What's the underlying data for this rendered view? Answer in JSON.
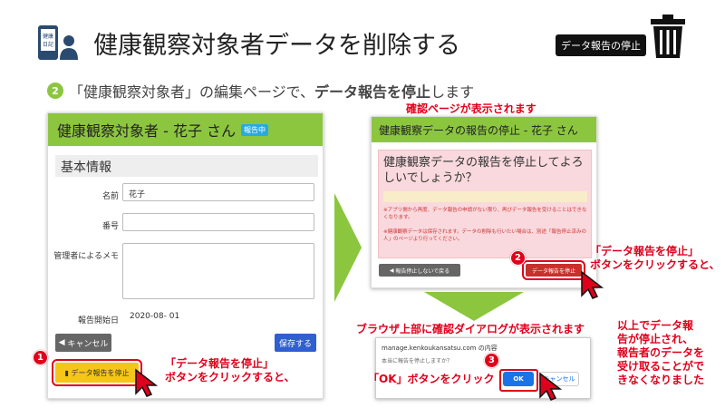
{
  "header": {
    "title": "健康観察対象者データを削除する",
    "badge": "データ報告の停止",
    "icon_text_line1": "健康",
    "icon_text_line2": "日記"
  },
  "step": {
    "number": "2",
    "text_before": "「健康観察対象者」の編集ページで、",
    "text_bold": "データ報告を停止",
    "text_after": "します"
  },
  "left_panel": {
    "title": "健康観察対象者 - 花子 さん",
    "status_badge": "報告中",
    "section": "基本情報",
    "fields": [
      {
        "label": "名前",
        "value": "花子"
      },
      {
        "label": "番号",
        "value": ""
      },
      {
        "label": "管理者によるメモ",
        "value": ""
      }
    ],
    "report_start_label": "報告開始日",
    "report_start_value": "2020-08- 01",
    "cancel_label": "キャンセル",
    "save_label": "保存する",
    "stop_label": "データ報告を停止"
  },
  "right_panel": {
    "caption": "確認ページが表示されます",
    "title": "健康観察データの報告の停止 - 花子 さん",
    "alert_title": "健康観察データの報告を停止してよろしいでしょうか？",
    "note1": "※アプリ側から再度、データ報告の申請がない限り、再びデータ報告を受けることはできなくなります。",
    "note2": "※健康観察データは保存されます。データの削除も行いたい場合は、別途「報告停止済みの人」のページより行ってください。",
    "back_label": "報告停止しないで戻る",
    "stop_label": "データ報告を停止"
  },
  "dialog": {
    "caption": "ブラウザ上部に確認ダイアログが表示されます",
    "host": "manage.kenkoukansatsu.com の内容",
    "question": "本当に報告を停止しますか？",
    "ok_label": "OK",
    "cancel_label": "キャンセル"
  },
  "callouts": {
    "step1_num": "1",
    "step1_line1": "「データ報告を停止」",
    "step1_line2": "ボタンをクリックすると、",
    "step2_num": "2",
    "step2_line1": "「データ報告を停止」",
    "step2_line2": "ボタンをクリックすると、",
    "step3_num": "3",
    "step3_text": "「OK」ボタンをクリック",
    "result_line1": "以上でデータ報",
    "result_line2": "告が停止され、",
    "result_line3": "報告者のデータを",
    "result_line4": "受け取ることがで",
    "result_line5": "きなくなりました"
  },
  "colors": {
    "accent_green": "#8cc63f",
    "annotation_red": "#e0001b",
    "save_blue": "#2f5fd0",
    "stop_yellow": "#f5c518",
    "stop_red": "#c9302c"
  }
}
